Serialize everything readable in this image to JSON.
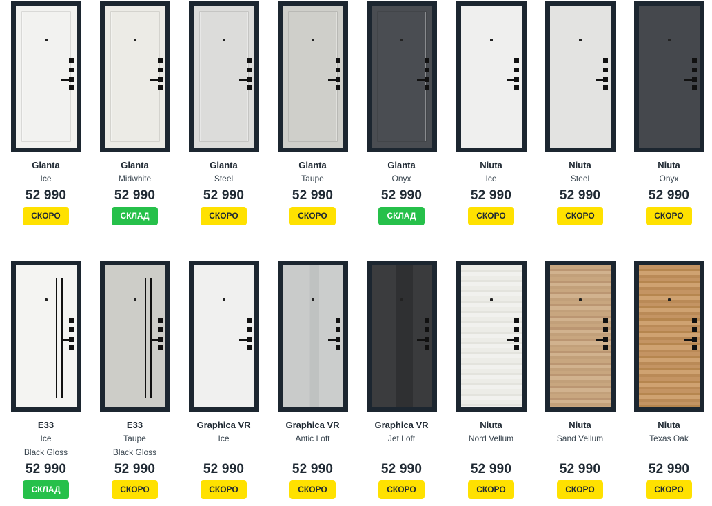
{
  "products": [
    {
      "name": "Glanta",
      "finish": [
        "Ice"
      ],
      "price": "52 990",
      "status": "СКОРО",
      "status_type": "soon",
      "door_color": "#f2f2f0",
      "style": "panel"
    },
    {
      "name": "Glanta",
      "finish": [
        "Midwhite"
      ],
      "price": "52 990",
      "status": "СКЛАД",
      "status_type": "stock",
      "door_color": "#ecebe6",
      "style": "panel"
    },
    {
      "name": "Glanta",
      "finish": [
        "Steel"
      ],
      "price": "52 990",
      "status": "СКОРО",
      "status_type": "soon",
      "door_color": "#dcdcda",
      "style": "panel"
    },
    {
      "name": "Glanta",
      "finish": [
        "Taupe"
      ],
      "price": "52 990",
      "status": "СКОРО",
      "status_type": "soon",
      "door_color": "#cfcfca",
      "style": "panel"
    },
    {
      "name": "Glanta",
      "finish": [
        "Onyx"
      ],
      "price": "52 990",
      "status": "СКЛАД",
      "status_type": "stock",
      "door_color": "#4a4d52",
      "style": "panel"
    },
    {
      "name": "Niuta",
      "finish": [
        "Ice"
      ],
      "price": "52 990",
      "status": "СКОРО",
      "status_type": "soon",
      "door_color": "#efefee",
      "style": "flat"
    },
    {
      "name": "Niuta",
      "finish": [
        "Steel"
      ],
      "price": "52 990",
      "status": "СКОРО",
      "status_type": "soon",
      "door_color": "#e3e3e1",
      "style": "flat"
    },
    {
      "name": "Niuta",
      "finish": [
        "Onyx"
      ],
      "price": "52 990",
      "status": "СКОРО",
      "status_type": "soon",
      "door_color": "#45484d",
      "style": "flat"
    },
    {
      "name": "E33",
      "finish": [
        "Ice",
        "Black Gloss"
      ],
      "price": "52 990",
      "status": "СКЛАД",
      "status_type": "stock",
      "door_color": "#f4f4f2",
      "style": "stripes"
    },
    {
      "name": "E33",
      "finish": [
        "Taupe",
        "Black Gloss"
      ],
      "price": "52 990",
      "status": "СКОРО",
      "status_type": "soon",
      "door_color": "#cdcdc8",
      "style": "stripes"
    },
    {
      "name": "Graphica VR",
      "finish": [
        "Ice"
      ],
      "price": "52 990",
      "status": "СКОРО",
      "status_type": "soon",
      "door_color": "#f0f0ef",
      "style": "flat"
    },
    {
      "name": "Graphica VR",
      "finish": [
        "Antic Loft"
      ],
      "price": "52 990",
      "status": "СКОРО",
      "status_type": "soon",
      "door_color": "#c8cac9",
      "style": "loft1"
    },
    {
      "name": "Graphica VR",
      "finish": [
        "Jet Loft"
      ],
      "price": "52 990",
      "status": "СКОРО",
      "status_type": "soon",
      "door_color": "#393a3c",
      "style": "loft2"
    },
    {
      "name": "Niuta",
      "finish": [
        "Nord Vellum"
      ],
      "price": "52 990",
      "status": "СКОРО",
      "status_type": "soon",
      "door_color": "#ecece7",
      "style": "vellum1"
    },
    {
      "name": "Niuta",
      "finish": [
        "Sand Vellum"
      ],
      "price": "52 990",
      "status": "СКОРО",
      "status_type": "soon",
      "door_color": "#c8a67f",
      "style": "vellum2"
    },
    {
      "name": "Niuta",
      "finish": [
        "Texas Oak"
      ],
      "price": "52 990",
      "status": "СКОРО",
      "status_type": "soon",
      "door_color": "#c49463",
      "style": "vellum3"
    }
  ]
}
